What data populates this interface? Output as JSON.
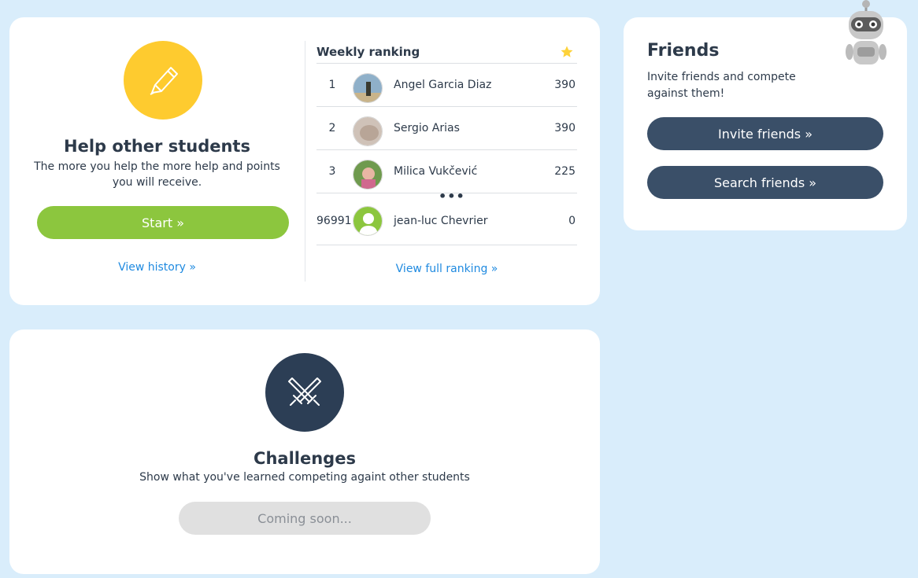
{
  "help": {
    "title": "Help other students",
    "subtitle": "The more you help the more help and points you will receive.",
    "start_label": "Start »",
    "history_link": "View history »",
    "icon": "pencil-icon"
  },
  "ranking": {
    "title": "Weekly ranking",
    "rows": [
      {
        "pos": "1",
        "name": "Angel Garcia Diaz",
        "points": "390"
      },
      {
        "pos": "2",
        "name": "Sergio Arias",
        "points": "390"
      },
      {
        "pos": "3",
        "name": "Milica Vukčević",
        "points": "225"
      }
    ],
    "ellipsis": "•••",
    "self": {
      "pos": "96991",
      "name": "jean-luc Chevrier",
      "points": "0"
    },
    "full_link": "View full ranking »"
  },
  "friends": {
    "title": "Friends",
    "subtitle": "Invite friends and compete against them!",
    "invite_label": "Invite friends »",
    "search_label": "Search friends »"
  },
  "challenges": {
    "title": "Challenges",
    "subtitle": "Show what you've learned competing againt other students",
    "coming_label": "Coming soon...",
    "icon": "crossed-swords-icon"
  },
  "colors": {
    "background": "#d9edfb",
    "yellow": "#fecb2f",
    "green": "#8cc63e",
    "navy": "#3a4f68",
    "link": "#1f8ae0"
  }
}
